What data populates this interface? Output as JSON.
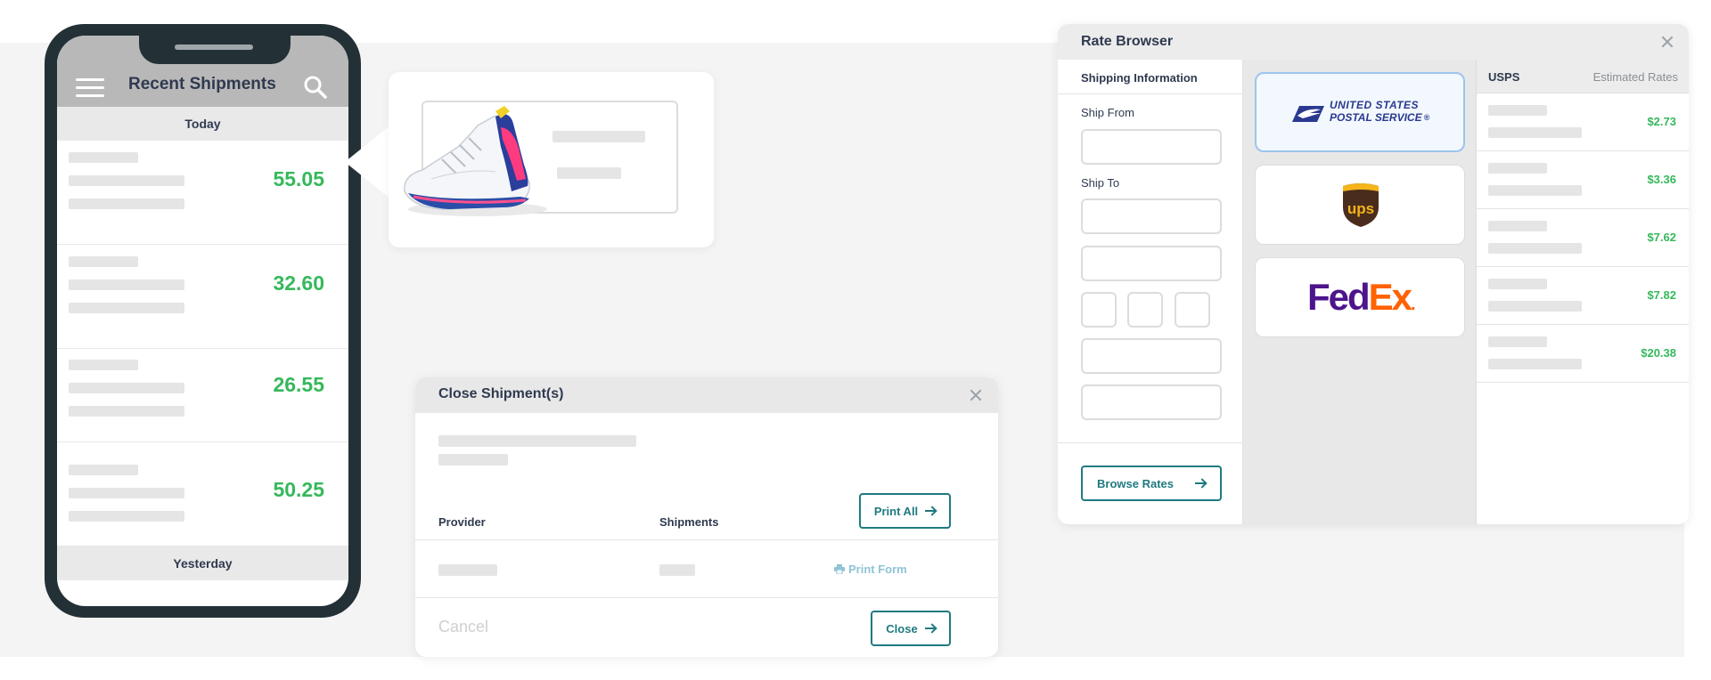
{
  "phone": {
    "title": "Recent Shipments",
    "today_label": "Today",
    "yesterday_label": "Yesterday",
    "shipments": [
      {
        "amount": "55.05"
      },
      {
        "amount": "32.60"
      },
      {
        "amount": "26.55"
      },
      {
        "amount": "50.25"
      }
    ],
    "icons": {
      "menu": "hamburger-icon",
      "search": "search-icon"
    }
  },
  "product_card": {
    "image": "sneaker"
  },
  "close_dialog": {
    "title": "Close Shipment(s)",
    "columns": {
      "provider": "Provider",
      "shipments": "Shipments"
    },
    "print_all_label": "Print All",
    "print_form_label": "Print Form",
    "cancel_label": "Cancel",
    "close_label": "Close"
  },
  "rate_browser": {
    "title": "Rate Browser",
    "shipping_info_label": "Shipping Information",
    "ship_from_label": "Ship From",
    "ship_to_label": "Ship To",
    "browse_rates_label": "Browse Rates",
    "carriers": [
      {
        "id": "usps",
        "line1": "UNITED STATES",
        "line2": "POSTAL SERVICE",
        "mark": "®",
        "selected": true
      },
      {
        "id": "ups",
        "text": "ups"
      },
      {
        "id": "fedex",
        "text_a": "Fed",
        "text_b": "Ex",
        "dot": "."
      }
    ],
    "rates_carrier": "USPS",
    "rates_header": "Estimated Rates",
    "rates": [
      "$2.73",
      "$3.36",
      "$7.62",
      "$7.82",
      "$20.38"
    ],
    "colors": {
      "accent": "#1f7a80",
      "rate_green": "#36b85c",
      "usps_blue": "#2a3990",
      "ups_brown": "#4a2c1d",
      "ups_gold": "#f4b41a",
      "fedex_purple": "#4d148c",
      "fedex_orange": "#ff6200"
    }
  }
}
